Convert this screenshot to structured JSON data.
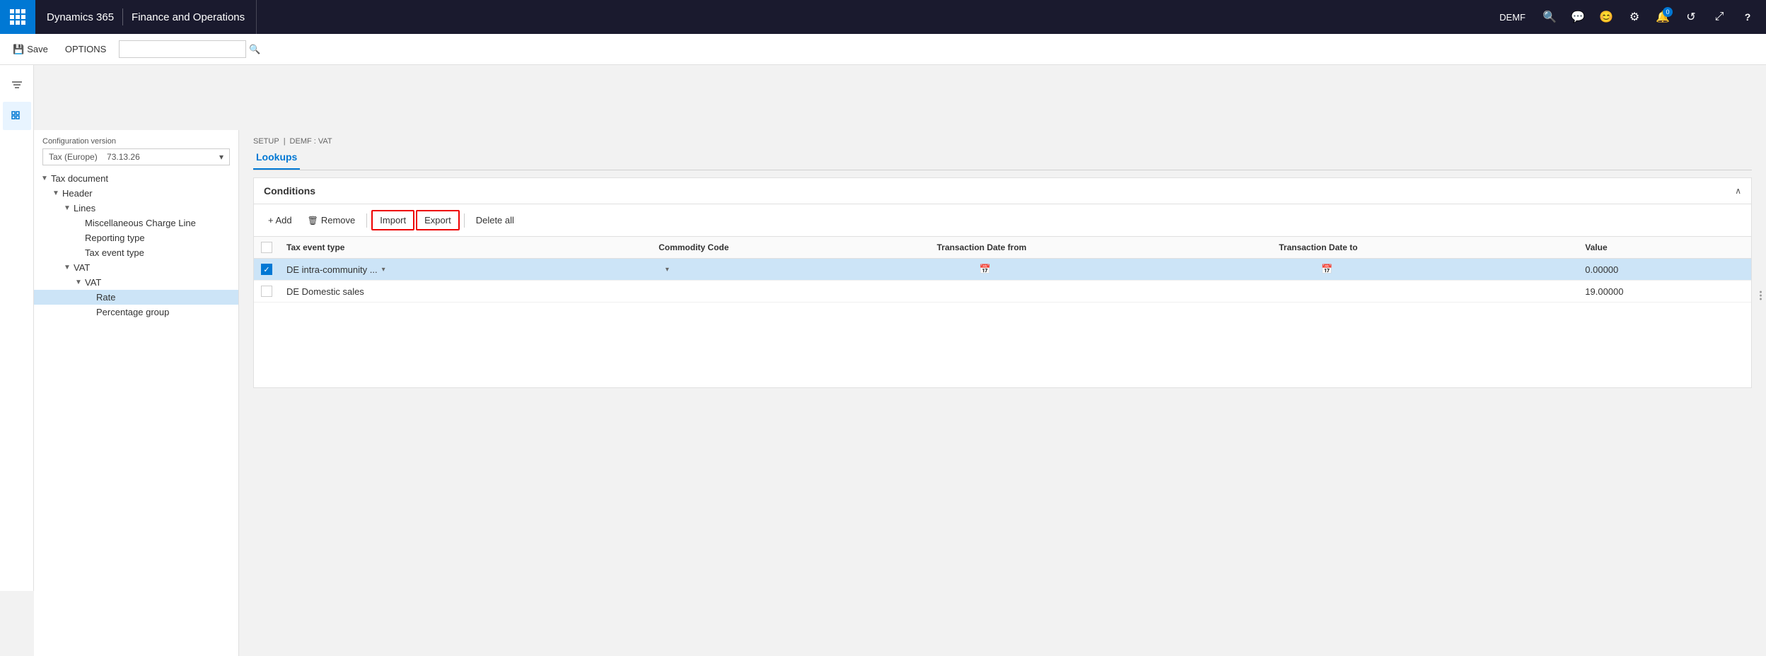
{
  "topnav": {
    "app_grid_label": "App menu",
    "brand_d365": "Dynamics 365",
    "separator": "|",
    "brand_fo": "Finance and Operations",
    "company": "DEMF",
    "icons": {
      "search": "🔍",
      "message": "💬",
      "user": "😊",
      "settings": "⚙",
      "help": "?"
    },
    "notification_count": "0"
  },
  "toolbar": {
    "save_label": "Save",
    "options_label": "OPTIONS",
    "save_icon": "💾"
  },
  "left_sidebar": {
    "filter_icon": "▼",
    "menu_icon": "≡"
  },
  "config": {
    "label": "Configuration version",
    "value": "Tax (Europe)",
    "version": "73.13.26"
  },
  "tree": {
    "items": [
      {
        "id": "tax-document",
        "label": "Tax document",
        "level": 0,
        "toggle": "▼",
        "active": false
      },
      {
        "id": "header",
        "label": "Header",
        "level": 1,
        "toggle": "▼",
        "active": false
      },
      {
        "id": "lines",
        "label": "Lines",
        "level": 2,
        "toggle": "▼",
        "active": false
      },
      {
        "id": "misc-charge-line",
        "label": "Miscellaneous Charge Line",
        "level": 3,
        "toggle": "",
        "active": false
      },
      {
        "id": "reporting-type",
        "label": "Reporting type",
        "level": 3,
        "toggle": "",
        "active": false
      },
      {
        "id": "tax-event-type",
        "label": "Tax event type",
        "level": 3,
        "toggle": "",
        "active": false
      },
      {
        "id": "vat",
        "label": "VAT",
        "level": 2,
        "toggle": "▼",
        "active": false
      },
      {
        "id": "vat2",
        "label": "VAT",
        "level": 3,
        "toggle": "▼",
        "active": false
      },
      {
        "id": "rate",
        "label": "Rate",
        "level": 4,
        "toggle": "",
        "active": true
      },
      {
        "id": "percentage-group",
        "label": "Percentage group",
        "level": 4,
        "toggle": "",
        "active": false
      }
    ]
  },
  "breadcrumb": {
    "part1": "SETUP",
    "sep": "|",
    "part2": "DEMF : VAT"
  },
  "page_title": "Lookups",
  "conditions": {
    "title": "Conditions",
    "collapse_icon": "∧"
  },
  "table_toolbar": {
    "add": "+ Add",
    "remove_icon": "🗑",
    "remove": "Remove",
    "import": "Import",
    "export": "Export",
    "delete_all": "Delete all"
  },
  "table": {
    "columns": [
      {
        "id": "check",
        "label": "✓"
      },
      {
        "id": "tax-event-type",
        "label": "Tax event type"
      },
      {
        "id": "commodity-code",
        "label": "Commodity Code"
      },
      {
        "id": "transaction-date-from",
        "label": "Transaction Date from"
      },
      {
        "id": "transaction-date-to",
        "label": "Transaction Date to"
      },
      {
        "id": "value",
        "label": "Value"
      }
    ],
    "rows": [
      {
        "selected": true,
        "tax_event_type": "DE intra-community ...",
        "commodity_code": "",
        "date_from": "",
        "date_to": "",
        "value": "0.00000",
        "has_dropdown_tax": true,
        "has_dropdown_commodity": true,
        "has_cal_from": true,
        "has_cal_to": true
      },
      {
        "selected": false,
        "tax_event_type": "DE Domestic sales",
        "commodity_code": "",
        "date_from": "",
        "date_to": "",
        "value": "19.00000",
        "has_dropdown_tax": false,
        "has_dropdown_commodity": false,
        "has_cal_from": false,
        "has_cal_to": false
      }
    ]
  },
  "drag_handle_dots": "•••"
}
